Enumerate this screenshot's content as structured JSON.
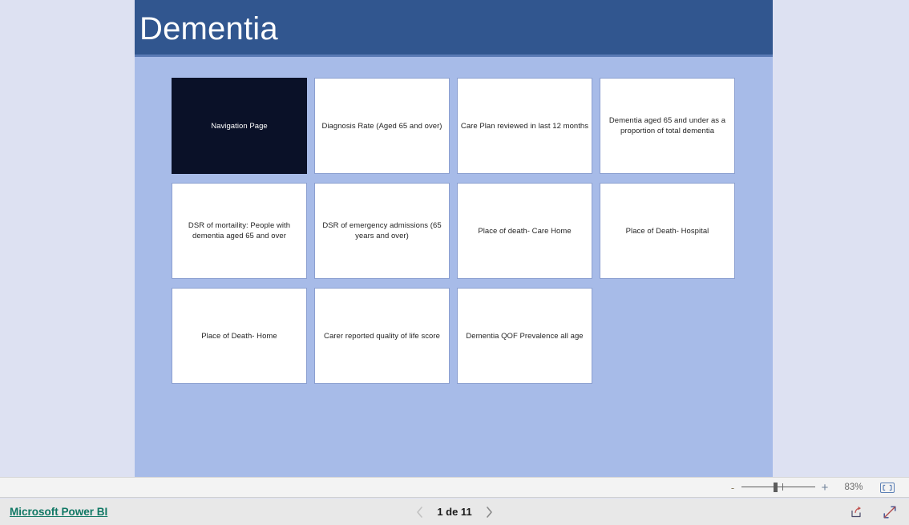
{
  "report": {
    "title": "Dementia",
    "header_bg": "#31568f",
    "canvas_bg": "#a7bbe8",
    "page_bg": "#dde1f2",
    "tile_border": "#8b9fd0",
    "active_tile_bg": "#0a1128"
  },
  "tiles": [
    [
      {
        "label": "Navigation Page",
        "active": true
      },
      {
        "label": "Diagnosis Rate (Aged 65 and over)",
        "active": false
      },
      {
        "label": "Care Plan reviewed in last 12 months",
        "active": false
      },
      {
        "label": "Dementia aged 65 and under as a proportion of total dementia",
        "active": false
      }
    ],
    [
      {
        "label": "DSR of mortaility: People with dementia aged 65 and over",
        "active": false
      },
      {
        "label": "DSR of emergency admissions (65 years and over)",
        "active": false
      },
      {
        "label": "Place of death- Care Home",
        "active": false
      },
      {
        "label": "Place of Death- Hospital",
        "active": false
      }
    ],
    [
      {
        "label": "Place of Death- Home",
        "active": false
      },
      {
        "label": "Carer reported quality of life score",
        "active": false
      },
      {
        "label": "Dementia QOF Prevalence all age",
        "active": false
      }
    ]
  ],
  "zoom_bar": {
    "minus_label": "-",
    "plus_label": "+",
    "zoom_value": "83%",
    "fit_icon": "fit-to-page-icon"
  },
  "footer": {
    "brand_label": "Microsoft Power BI",
    "brand_color": "#117865",
    "page_label": "1 de 11",
    "prev_icon": "chevron-left-icon",
    "next_icon": "chevron-right-icon",
    "share_icon": "share-icon",
    "fullscreen_icon": "fullscreen-icon"
  }
}
